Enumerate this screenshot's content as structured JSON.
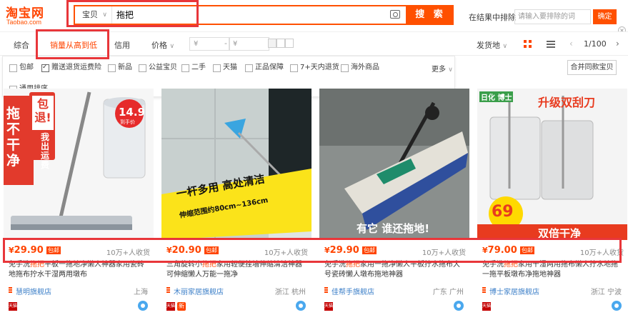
{
  "logo": {
    "big": "淘宝网",
    "small": "Taobao.com"
  },
  "search": {
    "scope": "宝贝",
    "query": "拖把",
    "button": "搜 索"
  },
  "exclude": {
    "label": "在结果中排除",
    "placeholder": "请输入要排除的词",
    "button": "确定"
  },
  "sort": {
    "default": "综合",
    "sales": "销量从高到低",
    "credit": "信用",
    "price": "价格",
    "price_min_placeholder": "¥",
    "price_max_placeholder": "¥",
    "price_dash": "-",
    "ship_from": "发货地",
    "page": "1/100"
  },
  "filters": {
    "row1": [
      {
        "label": "包邮",
        "checked": false
      },
      {
        "label": "赠送退货运费险",
        "checked": true
      },
      {
        "label": "新品",
        "checked": false
      },
      {
        "label": "公益宝贝",
        "checked": false
      },
      {
        "label": "二手",
        "checked": false
      },
      {
        "label": "天猫",
        "checked": false
      },
      {
        "label": "正品保障",
        "checked": false
      },
      {
        "label": "7+天内退货",
        "checked": false
      },
      {
        "label": "海外商品",
        "checked": false
      }
    ],
    "row2": [
      {
        "label": "通用排序",
        "checked": false
      }
    ],
    "more": "更多",
    "merge": "合并同款宝贝"
  },
  "products": [
    {
      "price_symbol": "¥",
      "price": "29.90",
      "free_shipping": "包邮",
      "sold": "10万+人收货",
      "title_prefix": "免手洗",
      "title_highlight": "拖把",
      "title_rest": "平板一拖地净懒人神器家用瓷砖地拖布拧水干湿两用墩布",
      "shop": "慧明旗舰店",
      "location": "上海",
      "tmall": "天猫",
      "new_tag": "",
      "img_text": {
        "a": "拖不干净",
        "b": "包退!",
        "c": "我出运费",
        "d": "14.9",
        "e": "到手价"
      }
    },
    {
      "price_symbol": "¥",
      "price": "20.90",
      "free_shipping": "包邮",
      "sold": "10万+人收货",
      "title_prefix": "三角旋转小",
      "title_highlight": "拖把",
      "title_rest": "家用轻便挂墙伸缩清洁神器可伸缩懒人万能一拖净",
      "shop": "木丽家居旗舰店",
      "location": "浙江 杭州",
      "tmall": "天猫",
      "new_tag": "新",
      "img_text": {
        "a": "一杆多用 高处清洁",
        "b": "伸缩范围约80cm~136cm"
      }
    },
    {
      "price_symbol": "¥",
      "price": "29.90",
      "free_shipping": "包邮",
      "sold": "10万+人收货",
      "title_prefix": "免手洗",
      "title_highlight": "拖把",
      "title_rest": "家用一拖净懒人平板拧水拖布大号瓷砖懒人墩布拖地神器",
      "shop": "佳帮手旗舰店",
      "location": "广东 广州",
      "tmall": "天猫",
      "new_tag": "",
      "img_text": {
        "a": "有它 谁还拖地!"
      }
    },
    {
      "price_symbol": "¥",
      "price": "79.00",
      "free_shipping": "包邮",
      "sold": "10万+人收货",
      "title_prefix": "免手洗",
      "title_highlight": "拖把",
      "title_rest": "家用干湿两用拖布懒人拧水地拖一拖平板墩布净拖地神器",
      "shop": "博士家居旗舰店",
      "location": "浙江 宁波",
      "tmall": "天猫",
      "new_tag": "",
      "img_text": {
        "brand": "日化 博士",
        "a": "升级双刮刀",
        "b": "69",
        "c": "双倍干净"
      }
    }
  ],
  "colors": {
    "accent": "#ff5000",
    "price": "#ff4400",
    "annotation": "#e8363a",
    "link": "#3c7fc8"
  }
}
